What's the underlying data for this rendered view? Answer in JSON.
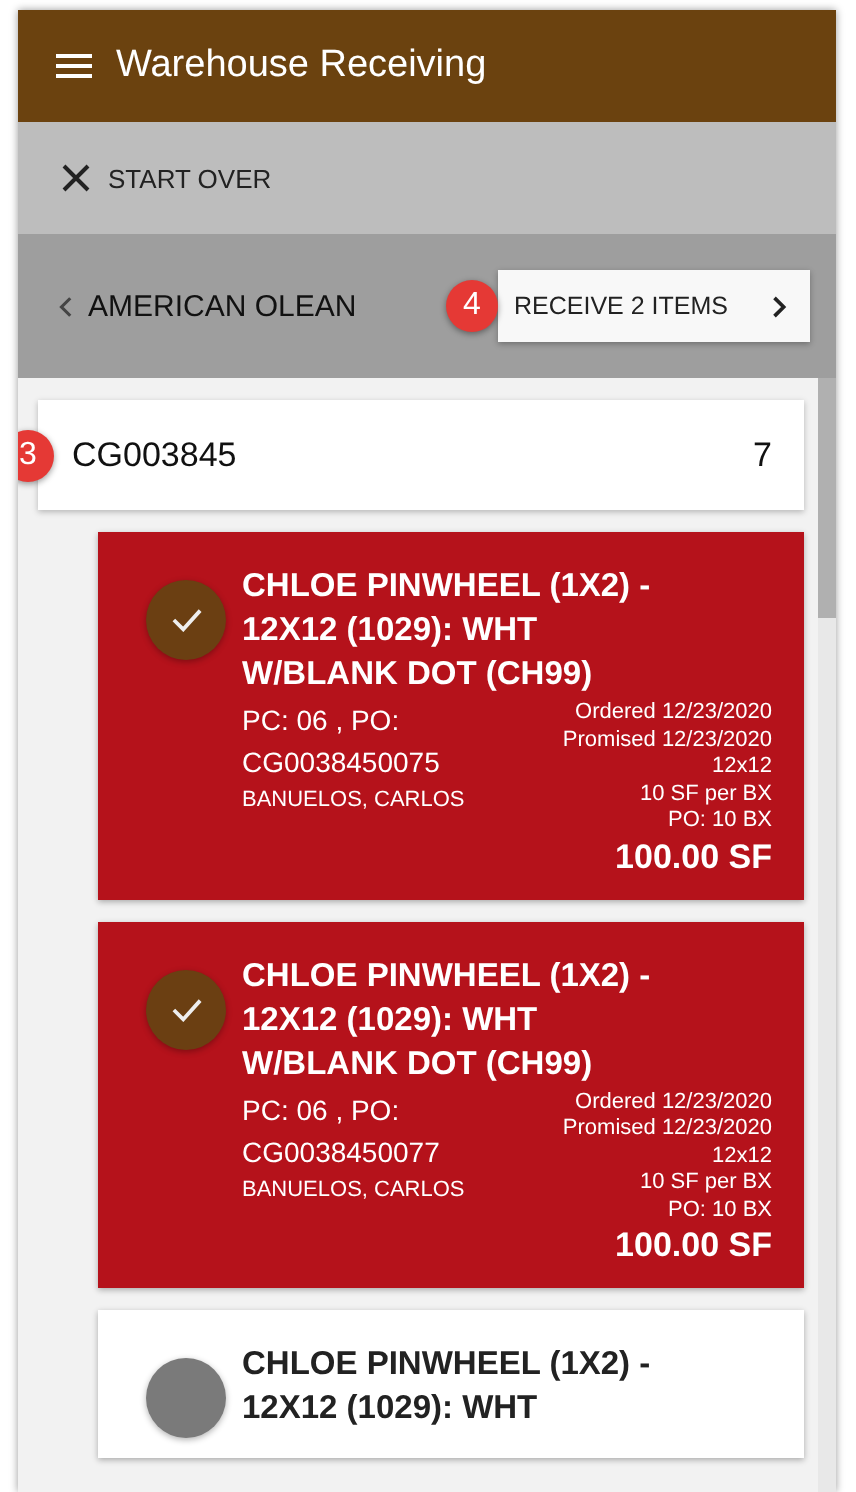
{
  "app_bar": {
    "title": "Warehouse Receiving"
  },
  "start_over": {
    "label": "START OVER"
  },
  "vendor_bar": {
    "vendor": "AMERICAN OLEAN",
    "receive_button": "RECEIVE 2 ITEMS",
    "receive_badge": "4"
  },
  "group": {
    "code": "CG003845",
    "count": "7",
    "badge": "3"
  },
  "items": [
    {
      "selected": true,
      "title": "CHLOE PINWHEEL (1X2) - 12X12 (1029): WHT W/BLANK DOT (CH99)",
      "pc_po": "PC: 06 , PO: CG0038450075",
      "person": "BANUELOS, CARLOS",
      "ordered": "Ordered 12/23/2020",
      "promised": "Promised 12/23/2020",
      "size": "12x12",
      "per_box": "10 SF per BX",
      "po_qty": "PO: 10 BX",
      "quantity": "100.00 SF"
    },
    {
      "selected": true,
      "title": "CHLOE PINWHEEL (1X2) - 12X12 (1029): WHT W/BLANK DOT (CH99)",
      "pc_po": "PC: 06 , PO: CG0038450077",
      "person": "BANUELOS, CARLOS",
      "ordered": "Ordered 12/23/2020",
      "promised": "Promised 12/23/2020",
      "size": "12x12",
      "per_box": "10 SF per BX",
      "po_qty": "PO: 10 BX",
      "quantity": "100.00 SF"
    },
    {
      "selected": false,
      "title": "CHLOE PINWHEEL (1X2) - 12X12 (1029): WHT"
    }
  ]
}
